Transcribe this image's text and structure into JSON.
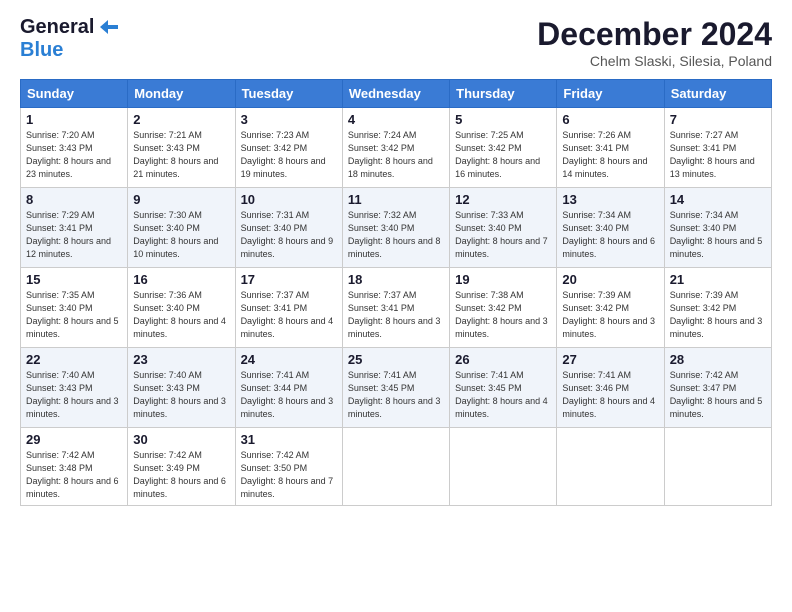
{
  "header": {
    "logo_line1": "General",
    "logo_line2": "Blue",
    "month": "December 2024",
    "location": "Chelm Slaski, Silesia, Poland"
  },
  "days_of_week": [
    "Sunday",
    "Monday",
    "Tuesday",
    "Wednesday",
    "Thursday",
    "Friday",
    "Saturday"
  ],
  "weeks": [
    [
      {
        "day": 1,
        "sunrise": "7:20 AM",
        "sunset": "3:43 PM",
        "daylight": "8 hours and 23 minutes."
      },
      {
        "day": 2,
        "sunrise": "7:21 AM",
        "sunset": "3:43 PM",
        "daylight": "8 hours and 21 minutes."
      },
      {
        "day": 3,
        "sunrise": "7:23 AM",
        "sunset": "3:42 PM",
        "daylight": "8 hours and 19 minutes."
      },
      {
        "day": 4,
        "sunrise": "7:24 AM",
        "sunset": "3:42 PM",
        "daylight": "8 hours and 18 minutes."
      },
      {
        "day": 5,
        "sunrise": "7:25 AM",
        "sunset": "3:42 PM",
        "daylight": "8 hours and 16 minutes."
      },
      {
        "day": 6,
        "sunrise": "7:26 AM",
        "sunset": "3:41 PM",
        "daylight": "8 hours and 14 minutes."
      },
      {
        "day": 7,
        "sunrise": "7:27 AM",
        "sunset": "3:41 PM",
        "daylight": "8 hours and 13 minutes."
      }
    ],
    [
      {
        "day": 8,
        "sunrise": "7:29 AM",
        "sunset": "3:41 PM",
        "daylight": "8 hours and 12 minutes."
      },
      {
        "day": 9,
        "sunrise": "7:30 AM",
        "sunset": "3:40 PM",
        "daylight": "8 hours and 10 minutes."
      },
      {
        "day": 10,
        "sunrise": "7:31 AM",
        "sunset": "3:40 PM",
        "daylight": "8 hours and 9 minutes."
      },
      {
        "day": 11,
        "sunrise": "7:32 AM",
        "sunset": "3:40 PM",
        "daylight": "8 hours and 8 minutes."
      },
      {
        "day": 12,
        "sunrise": "7:33 AM",
        "sunset": "3:40 PM",
        "daylight": "8 hours and 7 minutes."
      },
      {
        "day": 13,
        "sunrise": "7:34 AM",
        "sunset": "3:40 PM",
        "daylight": "8 hours and 6 minutes."
      },
      {
        "day": 14,
        "sunrise": "7:34 AM",
        "sunset": "3:40 PM",
        "daylight": "8 hours and 5 minutes."
      }
    ],
    [
      {
        "day": 15,
        "sunrise": "7:35 AM",
        "sunset": "3:40 PM",
        "daylight": "8 hours and 5 minutes."
      },
      {
        "day": 16,
        "sunrise": "7:36 AM",
        "sunset": "3:40 PM",
        "daylight": "8 hours and 4 minutes."
      },
      {
        "day": 17,
        "sunrise": "7:37 AM",
        "sunset": "3:41 PM",
        "daylight": "8 hours and 4 minutes."
      },
      {
        "day": 18,
        "sunrise": "7:37 AM",
        "sunset": "3:41 PM",
        "daylight": "8 hours and 3 minutes."
      },
      {
        "day": 19,
        "sunrise": "7:38 AM",
        "sunset": "3:42 PM",
        "daylight": "8 hours and 3 minutes."
      },
      {
        "day": 20,
        "sunrise": "7:39 AM",
        "sunset": "3:42 PM",
        "daylight": "8 hours and 3 minutes."
      },
      {
        "day": 21,
        "sunrise": "7:39 AM",
        "sunset": "3:42 PM",
        "daylight": "8 hours and 3 minutes."
      }
    ],
    [
      {
        "day": 22,
        "sunrise": "7:40 AM",
        "sunset": "3:43 PM",
        "daylight": "8 hours and 3 minutes."
      },
      {
        "day": 23,
        "sunrise": "7:40 AM",
        "sunset": "3:43 PM",
        "daylight": "8 hours and 3 minutes."
      },
      {
        "day": 24,
        "sunrise": "7:41 AM",
        "sunset": "3:44 PM",
        "daylight": "8 hours and 3 minutes."
      },
      {
        "day": 25,
        "sunrise": "7:41 AM",
        "sunset": "3:45 PM",
        "daylight": "8 hours and 3 minutes."
      },
      {
        "day": 26,
        "sunrise": "7:41 AM",
        "sunset": "3:45 PM",
        "daylight": "8 hours and 4 minutes."
      },
      {
        "day": 27,
        "sunrise": "7:41 AM",
        "sunset": "3:46 PM",
        "daylight": "8 hours and 4 minutes."
      },
      {
        "day": 28,
        "sunrise": "7:42 AM",
        "sunset": "3:47 PM",
        "daylight": "8 hours and 5 minutes."
      }
    ],
    [
      {
        "day": 29,
        "sunrise": "7:42 AM",
        "sunset": "3:48 PM",
        "daylight": "8 hours and 6 minutes."
      },
      {
        "day": 30,
        "sunrise": "7:42 AM",
        "sunset": "3:49 PM",
        "daylight": "8 hours and 6 minutes."
      },
      {
        "day": 31,
        "sunrise": "7:42 AM",
        "sunset": "3:50 PM",
        "daylight": "8 hours and 7 minutes."
      },
      null,
      null,
      null,
      null
    ]
  ]
}
